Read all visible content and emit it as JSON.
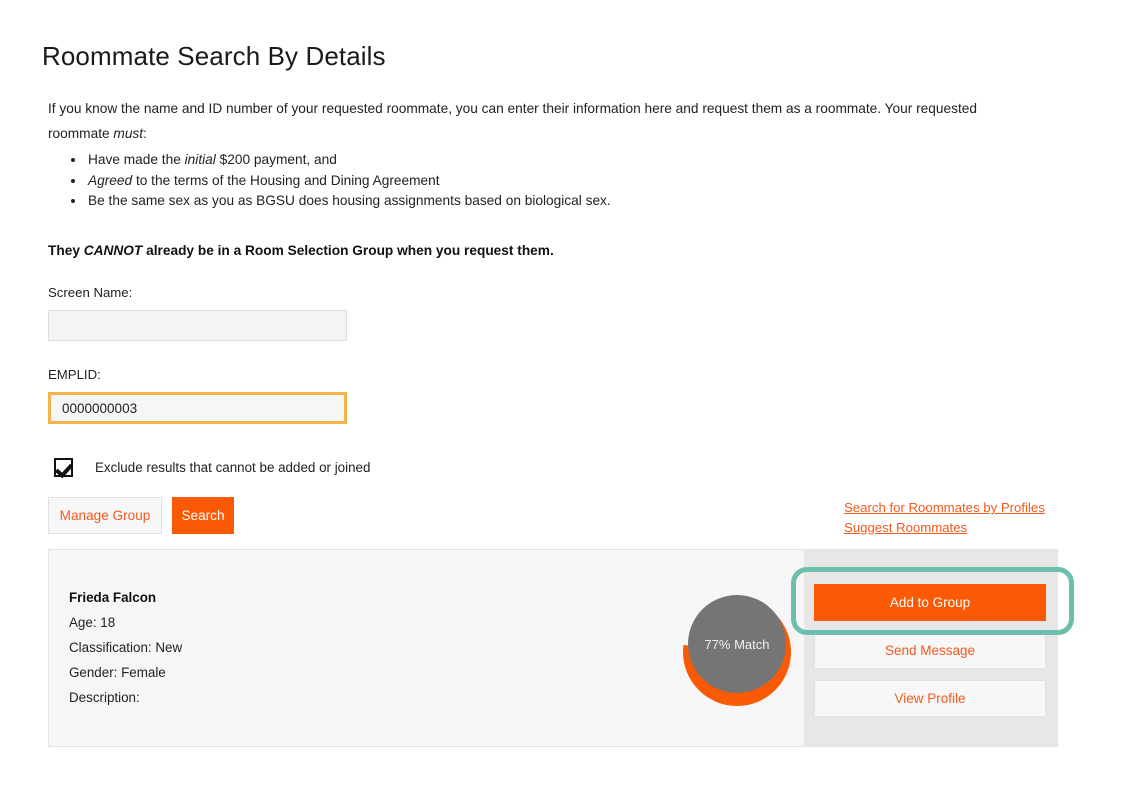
{
  "page": {
    "title": "Roommate Search By Details",
    "intro_part1": "If you know the name and ID number of your requested roommate, you can enter their information here and request them as a roommate. Your requested roommate ",
    "intro_emphasis": "must",
    "intro_part2": ":",
    "requirements": [
      {
        "pre": "Have made the ",
        "em": "initial",
        "post": " $200 payment, and"
      },
      {
        "pre": "",
        "em": "Agreed",
        "post": " to the terms of the Housing and Dining Agreement"
      },
      {
        "pre": "Be the same sex as you as BGSU does housing assignments based on biological sex.",
        "em": "",
        "post": ""
      }
    ],
    "cannot_pre": "They ",
    "cannot_em": "CANNOT",
    "cannot_post": " already be in a Room Selection Group when you request them."
  },
  "form": {
    "screen_name_label": "Screen Name:",
    "screen_name_value": "",
    "screen_name_placeholder": "",
    "emplid_label": "EMPLID:",
    "emplid_value": "0000000003",
    "emplid_placeholder": "",
    "exclude_checkbox_label": "Exclude results that cannot be added or joined",
    "exclude_checkbox_checked": "true",
    "manage_group_label": "Manage Group",
    "search_label": "Search"
  },
  "links": {
    "search_by_profiles": "Search for Roommates by Profiles",
    "suggest_roommates": "Suggest Roommates"
  },
  "result": {
    "name": "Frieda Falcon",
    "age": "Age: 18",
    "classification": "Classification: New",
    "gender": "Gender: Female",
    "description": "Description:",
    "match_label": "77% Match",
    "match_percent": 77,
    "actions": {
      "add_to_group": "Add to Group",
      "send_message": "Send Message",
      "view_profile": "View Profile"
    }
  },
  "colors": {
    "accent_orange": "#fa5a05",
    "link_orange": "#f4591e",
    "highlight_teal": "#6bbfac",
    "focus_amber": "#f0b44b",
    "match_gray": "#757575"
  }
}
